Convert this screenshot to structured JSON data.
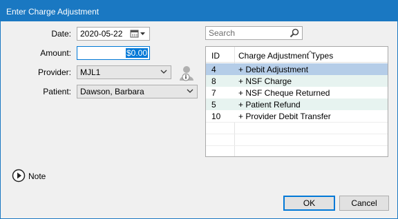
{
  "window": {
    "title": "Enter Charge Adjustment"
  },
  "form": {
    "date_label": "Date:",
    "date_value": "2020-05-22",
    "amount_label": "Amount:",
    "amount_value": "$0.00",
    "provider_label": "Provider:",
    "provider_value": "MJL1",
    "patient_label": "Patient:",
    "patient_value": "Dawson, Barbara"
  },
  "search": {
    "placeholder": "Search"
  },
  "grid": {
    "headers": {
      "id": "ID",
      "type": "Charge Adjustment Types"
    },
    "rows": [
      {
        "id": "4",
        "type": "+ Debit Adjustment"
      },
      {
        "id": "8",
        "type": "+ NSF Charge"
      },
      {
        "id": "7",
        "type": "+ NSF Cheque Returned"
      },
      {
        "id": "5",
        "type": "+ Patient Refund"
      },
      {
        "id": "10",
        "type": "+ Provider Debit Transfer"
      }
    ],
    "selected_index": 0
  },
  "note": {
    "label": "Note"
  },
  "buttons": {
    "ok": "OK",
    "cancel": "Cancel"
  },
  "colors": {
    "titlebar": "#1a78c2",
    "selected_row": "#b5cde8",
    "alt_row": "#e7f3f0",
    "amount_highlight": "#0078d7"
  },
  "icons": {
    "calendar": "calendar-icon",
    "search": "magnifier-icon",
    "provider_info": "person-info-icon",
    "note": "play-circle-icon"
  }
}
